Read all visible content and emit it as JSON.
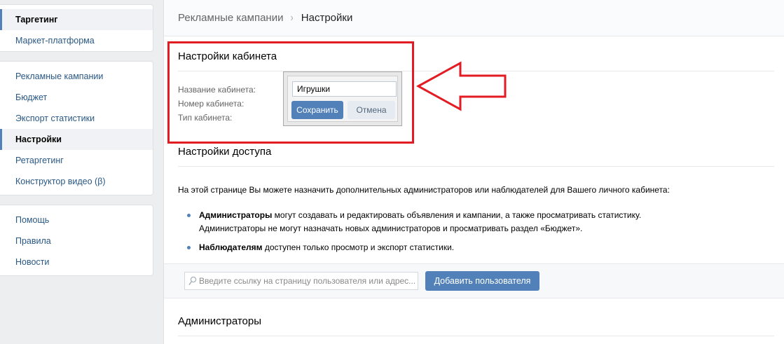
{
  "sidebar": {
    "top": [
      {
        "label": "Таргетинг"
      },
      {
        "label": "Маркет-платформа"
      }
    ],
    "middle": [
      {
        "label": "Рекламные кампании"
      },
      {
        "label": "Бюджет"
      },
      {
        "label": "Экспорт статистики"
      },
      {
        "label": "Настройки"
      },
      {
        "label": "Ретаргетинг"
      },
      {
        "label": "Конструктор видео (β)"
      }
    ],
    "bottom": [
      {
        "label": "Помощь"
      },
      {
        "label": "Правила"
      },
      {
        "label": "Новости"
      }
    ]
  },
  "breadcrumb": {
    "parent": "Рекламные кампании",
    "separator": "›",
    "current": "Настройки"
  },
  "cabinet_settings": {
    "title": "Настройки кабинета",
    "labels": {
      "name": "Название кабинета:",
      "number": "Номер кабинета:",
      "type": "Тип кабинета:"
    },
    "name_value": "Игрушки",
    "save_label": "Сохранить",
    "cancel_label": "Отмена"
  },
  "access_settings": {
    "title": "Настройки доступа",
    "description": "На этой странице Вы можете назначить дополнительных администраторов или наблюдателей для Вашего личного кабинета:",
    "bullets": {
      "admins_bold": "Администраторы",
      "admins_text": " могут создавать и редактировать объявления и кампании, а также просматривать статистику.",
      "admins_line2": "Администраторы не могут назначать новых администраторов и просматривать раздел «Бюджет».",
      "observers_bold": "Наблюдателям",
      "observers_text": " доступен только просмотр и экспорт статистики."
    },
    "search_placeholder": "Введите ссылку на страницу пользователя или адрес...",
    "add_user_label": "Добавить пользователя"
  },
  "administrators": {
    "title": "Администраторы"
  },
  "colors": {
    "accent": "#5181b8",
    "highlight": "#e31b23"
  }
}
